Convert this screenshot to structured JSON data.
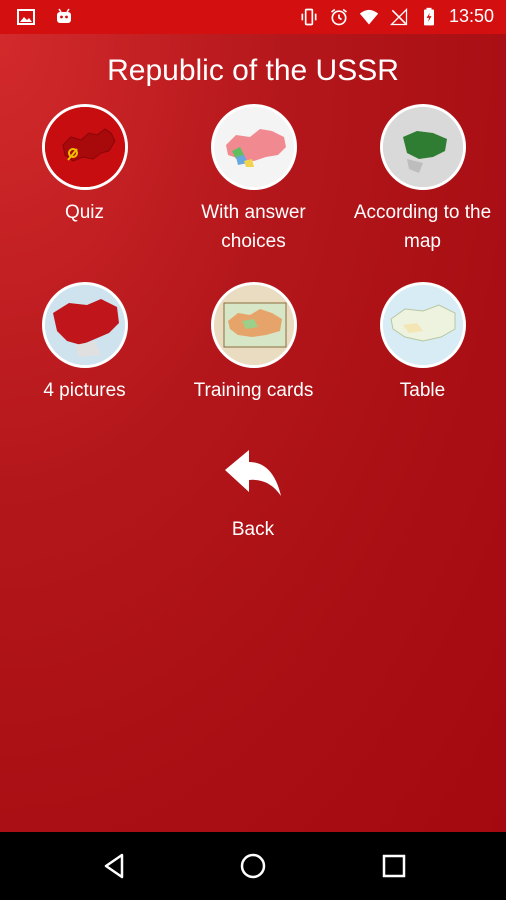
{
  "status_bar": {
    "time": "13:50",
    "icons": [
      "image-icon",
      "android-icon",
      "vibrate-icon",
      "alarm-icon",
      "wifi-icon",
      "no-signal-icon",
      "battery-charging-icon"
    ]
  },
  "title": "Republic of the USSR",
  "menu": [
    {
      "label": "Quiz",
      "icon": "soviet-flag-map-icon"
    },
    {
      "label": "With answer choices",
      "icon": "colored-republics-map-icon"
    },
    {
      "label": "According to the map",
      "icon": "globe-map-icon"
    },
    {
      "label": "4 pictures",
      "icon": "red-map-icon"
    },
    {
      "label": "Training cards",
      "icon": "vintage-map-icon"
    },
    {
      "label": "Table",
      "icon": "light-map-icon"
    }
  ],
  "back": {
    "label": "Back",
    "icon": "back-arrow-icon"
  },
  "nav_bar": {
    "icons": [
      "nav-back-icon",
      "nav-home-icon",
      "nav-recents-icon"
    ]
  }
}
